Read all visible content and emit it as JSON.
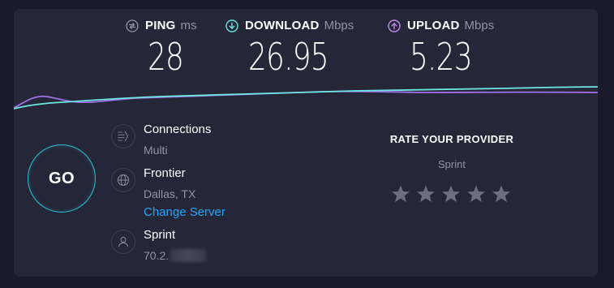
{
  "metrics": {
    "ping": {
      "label": "PING",
      "unit": "ms",
      "value": "28",
      "icon": "ping-icon",
      "color": "#9193a8"
    },
    "download": {
      "label": "DOWNLOAD",
      "unit": "Mbps",
      "value": "26.95",
      "icon": "download-arrow-icon",
      "color": "#6be6e0"
    },
    "upload": {
      "label": "UPLOAD",
      "unit": "Mbps",
      "value": "5.23",
      "icon": "upload-arrow-icon",
      "color": "#c08bf0"
    }
  },
  "go_button": {
    "label": "GO",
    "color": "#2bc0d1"
  },
  "connections": {
    "label": "Connections",
    "value": "Multi",
    "icon": "connections-icon"
  },
  "server": {
    "name": "Frontier",
    "location": "Dallas, TX",
    "change_label": "Change Server",
    "icon": "globe-icon"
  },
  "provider_info": {
    "name": "Sprint",
    "ip_visible": "70.2.",
    "icon": "person-icon"
  },
  "rating": {
    "title": "RATE YOUR PROVIDER",
    "provider": "Sprint",
    "stars_total": 5,
    "stars_selected": 0
  },
  "colors": {
    "background": "#1a1a2b",
    "card": "#252638",
    "accent_link": "#1ea7ff",
    "download_line": "#6be6e0",
    "upload_line": "#a070e8"
  }
}
